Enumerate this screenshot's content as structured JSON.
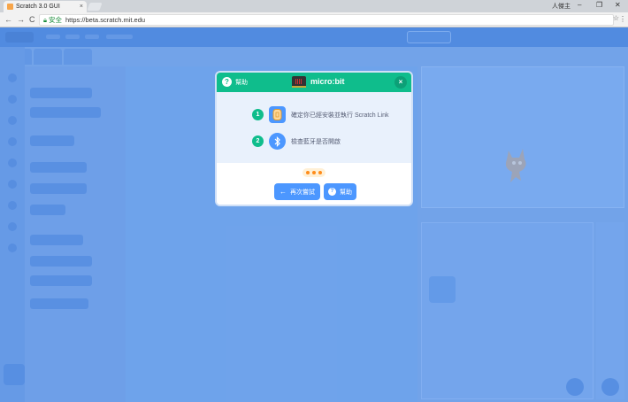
{
  "browser": {
    "tab_title": "Scratch 3.0 GUI",
    "tab_close": "×",
    "user_name": "人傑主",
    "win_min": "–",
    "win_max": "❐",
    "win_close": "✕",
    "nav_back": "←",
    "nav_forward": "→",
    "nav_reload": "C",
    "secure_label": "安全",
    "url": "https://beta.scratch.mit.edu",
    "star": "☆",
    "menu": "⋮"
  },
  "modal": {
    "header_help_icon": "?",
    "header_help_label": "幫助",
    "title": "micro:bit",
    "close_icon": "×",
    "steps": [
      {
        "number": "1",
        "text": "確定你已經安裝並執行 Scratch Link"
      },
      {
        "number": "2",
        "text": "檢查藍牙是否開啟"
      }
    ],
    "retry_icon": "←",
    "retry_label": "再次嘗試",
    "help_icon": "?",
    "help_label": "幫助"
  },
  "colors": {
    "header": "#0fbd8c",
    "button": "#4c97ff",
    "overlay": "#4d97ff",
    "step_number": "#0fbd8c",
    "dots": "#ff8c1a"
  },
  "icons": {
    "scratch_link": "scratch-link-icon",
    "bluetooth": "bluetooth-icon",
    "microbit": "microbit-icon"
  }
}
